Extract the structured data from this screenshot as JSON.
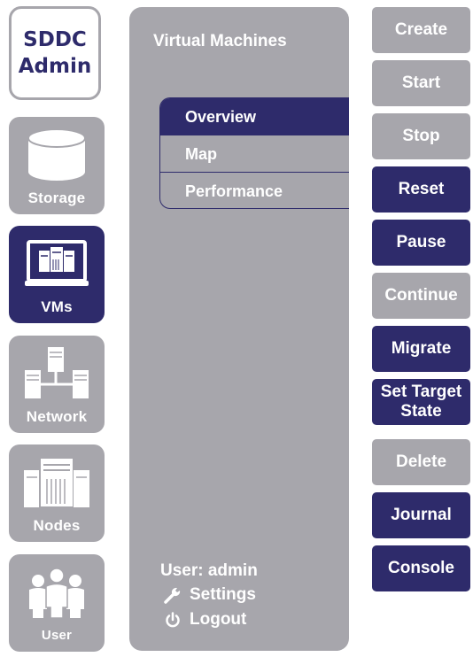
{
  "logo": {
    "line1": "SDDC",
    "line2": "Admin"
  },
  "nav": {
    "items": [
      {
        "label": "Storage",
        "icon": "database-icon",
        "active": false
      },
      {
        "label": "VMs",
        "icon": "monitor-servers-icon",
        "active": true
      },
      {
        "label": "Network",
        "icon": "network-servers-icon",
        "active": false
      },
      {
        "label": "Nodes",
        "icon": "server-rack-icon",
        "active": false
      },
      {
        "label": "User",
        "icon": "users-group-icon",
        "active": false
      }
    ]
  },
  "panel": {
    "title": "Virtual Machines",
    "menu": [
      {
        "label": "Overview",
        "active": true
      },
      {
        "label": "Map",
        "active": false
      },
      {
        "label": "Performance",
        "active": false
      }
    ],
    "user": "User: admin",
    "settings_label": "Settings",
    "logout_label": "Logout"
  },
  "actions": [
    {
      "label": "Create",
      "enabled": false
    },
    {
      "label": "Start",
      "enabled": false
    },
    {
      "label": "Stop",
      "enabled": false
    },
    {
      "label": "Reset",
      "enabled": true
    },
    {
      "label": "Pause",
      "enabled": true
    },
    {
      "label": "Continue",
      "enabled": false
    },
    {
      "label": "Migrate",
      "enabled": true
    },
    {
      "label": "Set Target State",
      "enabled": true
    },
    {
      "label": "Delete",
      "enabled": false
    },
    {
      "label": "Journal",
      "enabled": true
    },
    {
      "label": "Console",
      "enabled": true
    }
  ],
  "colors": {
    "accent": "#2e2b6b",
    "disabled": "#a7a6ac",
    "text_on_dark": "#ffffff"
  }
}
